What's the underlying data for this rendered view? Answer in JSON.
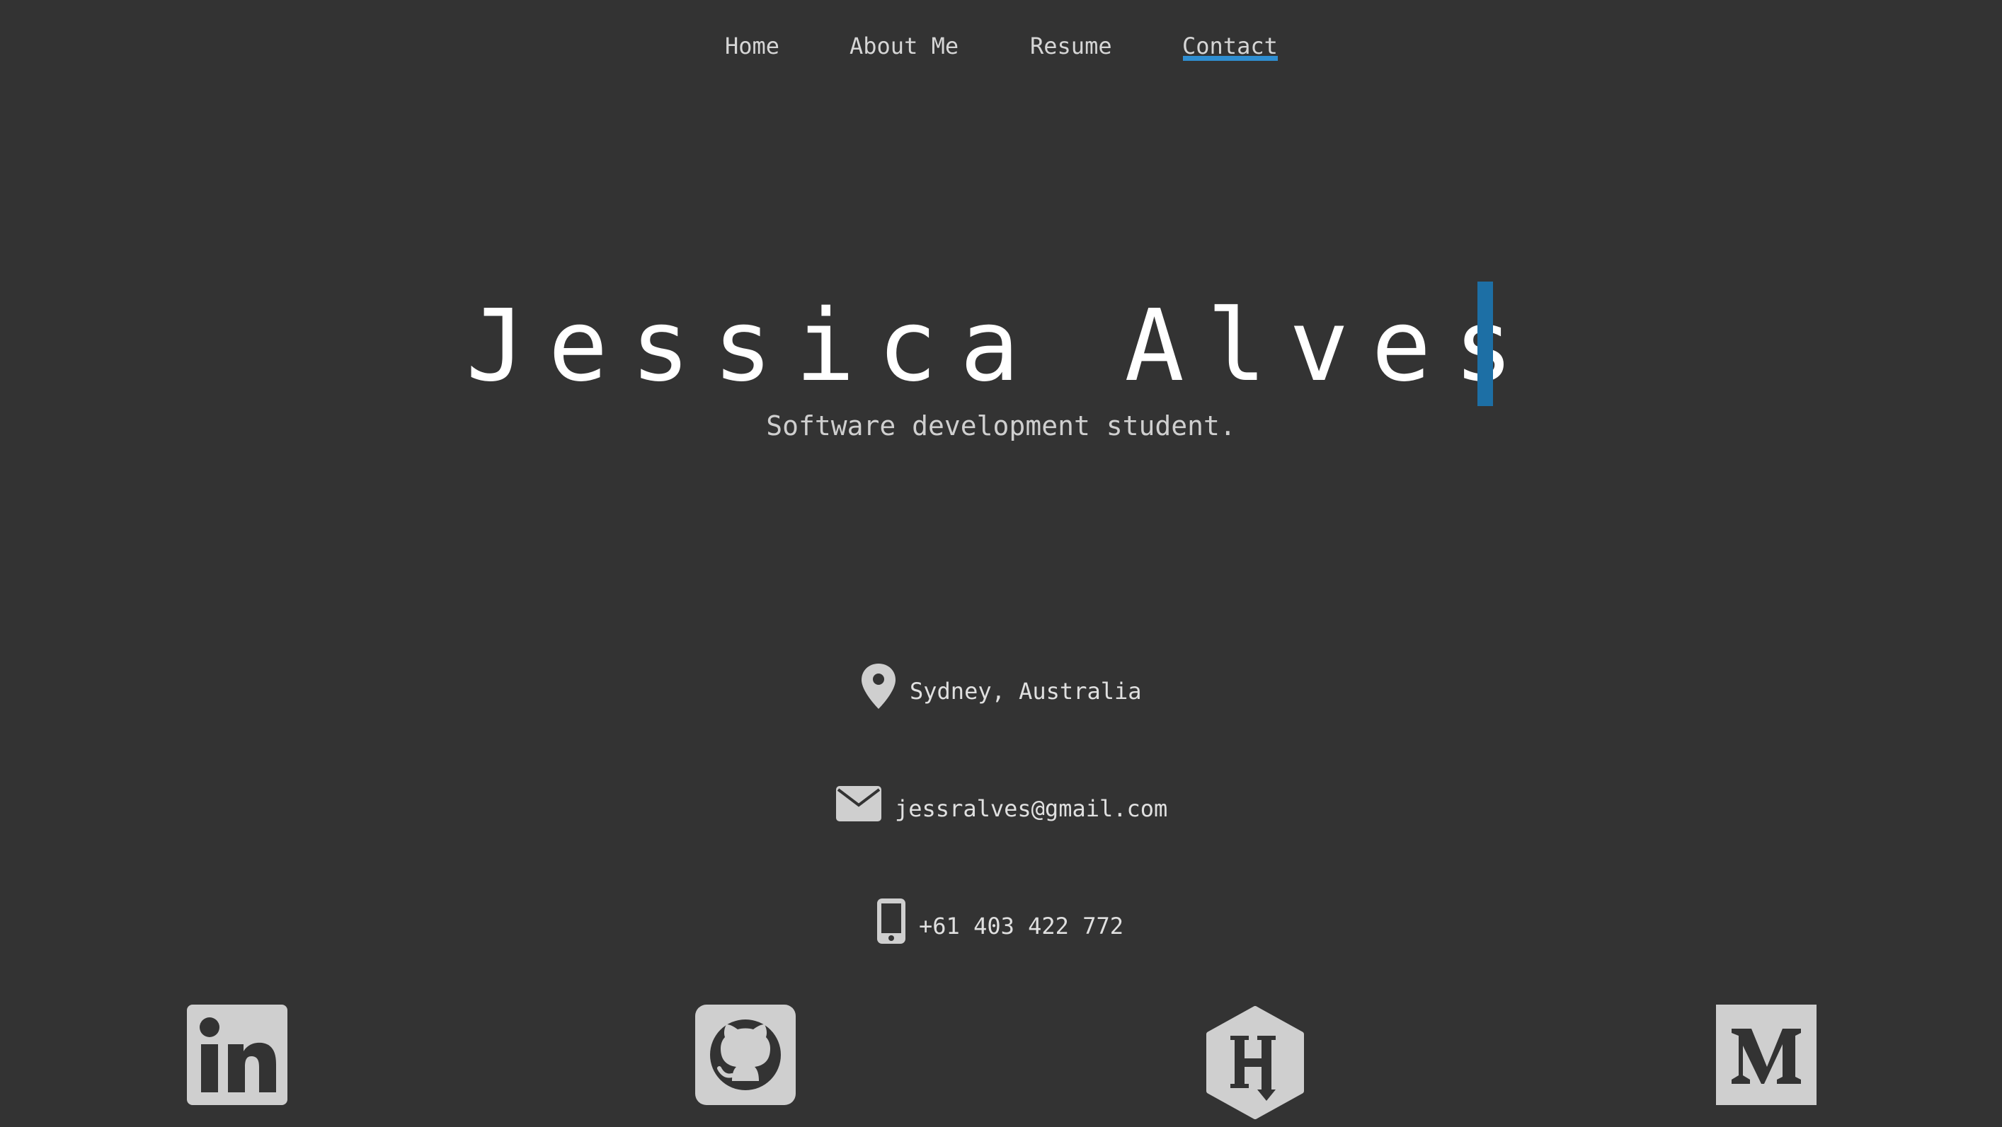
{
  "nav": {
    "items": [
      {
        "label": "Home"
      },
      {
        "label": "About Me"
      },
      {
        "label": "Resume"
      },
      {
        "label": "Contact",
        "active": true
      }
    ],
    "accent_color": "#2f8ed1"
  },
  "hero": {
    "name": "Jessica Alves",
    "subtitle": "Software development student.",
    "cursor_color": "#1d6fa5"
  },
  "contact": {
    "location": {
      "icon": "map-pin-icon",
      "text": "Sydney, Australia"
    },
    "email": {
      "icon": "envelope-icon",
      "text": "jessralves@gmail.com"
    },
    "phone": {
      "icon": "mobile-phone-icon",
      "text": "+61 403 422 772"
    }
  },
  "social": [
    {
      "icon": "linkedin-icon",
      "name": "LinkedIn"
    },
    {
      "icon": "github-icon",
      "name": "GitHub"
    },
    {
      "icon": "hashnode-icon",
      "name": "Hashnode"
    },
    {
      "icon": "medium-icon",
      "name": "Medium"
    }
  ],
  "colors": {
    "background": "#333333",
    "text": "#d6d6d6",
    "icon": "#cfcfcf"
  }
}
